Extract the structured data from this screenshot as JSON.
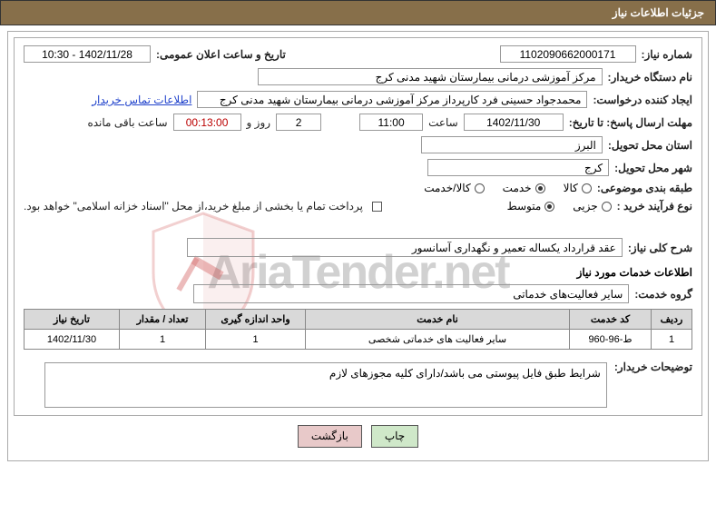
{
  "header": "جزئیات اطلاعات نیاز",
  "request_no_label": "شماره نیاز:",
  "request_no": "1102090662000171",
  "announce_label": "تاریخ و ساعت اعلان عمومی:",
  "announce_val": "1402/11/28 - 10:30",
  "buyer_org_label": "نام دستگاه خریدار:",
  "buyer_org": "مرکز آموزشی درمانی بیمارستان شهید مدنی کرج",
  "requester_label": "ایجاد کننده درخواست:",
  "requester": "محمدجواد حسینی فرد کارپرداز مرکز آموزشی درمانی بیمارستان شهید مدنی کرج",
  "contact_link": "اطلاعات تماس خریدار",
  "deadline_label": "مهلت ارسال پاسخ: تا تاریخ:",
  "deadline_date": "1402/11/30",
  "hour_label": "ساعت",
  "deadline_time": "11:00",
  "days_val": "2",
  "day_and_word": "روز و",
  "timer_val": "00:13:00",
  "remain_label": "ساعت باقی مانده",
  "province_label": "استان محل تحویل:",
  "province": "البرز",
  "city_label": "شهر محل تحویل:",
  "city": "کرج",
  "category_label": "طبقه بندی موضوعی:",
  "cat_options": {
    "a": "کالا",
    "b": "خدمت",
    "c": "کالا/خدمت"
  },
  "process_label": "نوع فرآیند خرید :",
  "proc_options": {
    "a": "جزیی",
    "b": "متوسط"
  },
  "payment_note": "پرداخت تمام یا بخشی از مبلغ خرید،از محل \"اسناد خزانه اسلامی\" خواهد بود.",
  "desc_label": "شرح کلی نیاز:",
  "desc_val": "عقد قرارداد یکساله تعمیر و نگهداری آسانسور",
  "services_title": "اطلاعات خدمات مورد نیاز",
  "service_group_label": "گروه خدمت:",
  "service_group_val": "سایر فعالیت‌های خدماتی",
  "table": {
    "headers": {
      "row": "ردیف",
      "code": "کد خدمت",
      "name": "نام خدمت",
      "unit": "واحد اندازه گیری",
      "qty": "تعداد / مقدار",
      "date": "تاریخ نیاز"
    },
    "rows": [
      {
        "row": "1",
        "code": "ط-96-960",
        "name": "سایر فعالیت های خدماتی شخصی",
        "unit": "1",
        "qty": "1",
        "date": "1402/11/30"
      }
    ]
  },
  "buyer_notes_label": "توضیحات خریدار:",
  "buyer_notes": "شرایط طبق فایل پیوستی می باشد/دارای کلیه مجوزهای لازم",
  "btn_print": "چاپ",
  "btn_back": "بازگشت",
  "watermark_text": "AriaTender.net"
}
